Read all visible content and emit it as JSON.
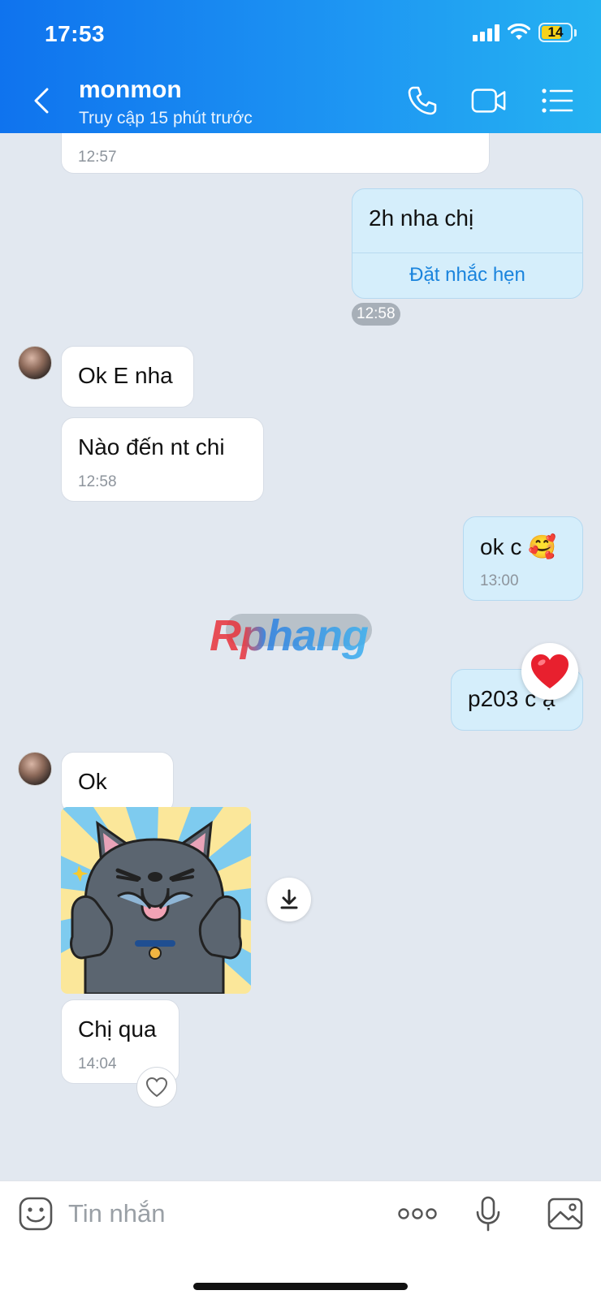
{
  "status_bar": {
    "time": "17:53",
    "battery": "14"
  },
  "header": {
    "contact_name": "monmon",
    "contact_status": "Truy cập 15 phút trước",
    "icons": [
      "back-icon",
      "phone-icon",
      "video-call-icon",
      "menu-list-icon"
    ]
  },
  "messages": {
    "m0": {
      "time": "12:57"
    },
    "m1": {
      "text": "2h nha chị",
      "action": "Đặt nhắc hẹn",
      "time": "12:58"
    },
    "m2": {
      "text": "Ok E nha"
    },
    "m3": {
      "text": "Nào đến  nt chi",
      "time": "12:58"
    },
    "m4": {
      "text": "ok c 🥰",
      "time": "13:00"
    },
    "m5": {
      "text": "p203 c ạ"
    },
    "m6": {
      "text": "Ok"
    },
    "m7": {
      "sticker": "cat-thumbs-up-sticker"
    },
    "m8": {
      "text": "Chị qua",
      "time": "14:04"
    }
  },
  "watermark": {
    "text": "Rphang"
  },
  "composer": {
    "placeholder": "Tin nhắn",
    "icons": [
      "emoji-icon",
      "more-dots-icon",
      "microphone-icon",
      "image-gallery-icon"
    ]
  },
  "colors": {
    "header_gradient_start": "#0f73ee",
    "header_gradient_end": "#25b2f1",
    "chat_background": "#e2e8f0",
    "outgoing_bubble": "#d5eefb",
    "incoming_bubble": "#ffffff",
    "link_blue": "#1a84dd",
    "reaction_heart": "#e8202e"
  }
}
